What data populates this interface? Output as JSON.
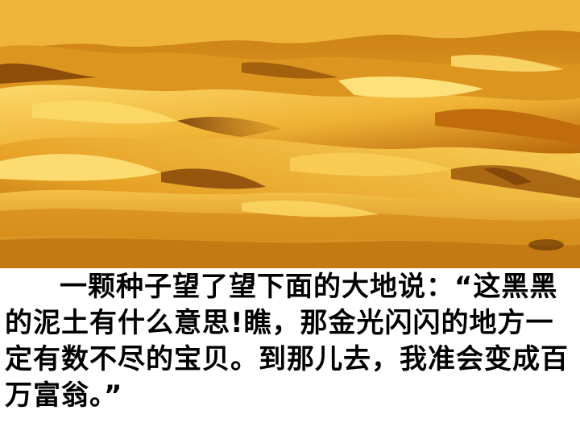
{
  "slide": {
    "image_description_name": "desert-dunes-photo",
    "caption": "一颗种子望了望下面的大地说：“这黑黑的泥土有什么意思!瞧，那金光闪闪的地方一定有数不尽的宝贝。到那儿去，我准会变成百万富翁。”"
  },
  "colors": {
    "sand_light": "#f6c447",
    "sand_mid": "#e69a1c",
    "sand_dark": "#8a4a06",
    "shadow": "#5a2c02",
    "text": "#000000",
    "background": "#ffffff"
  }
}
